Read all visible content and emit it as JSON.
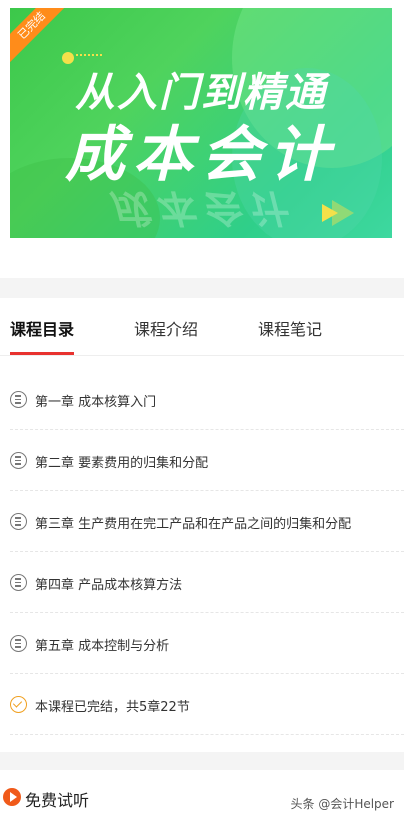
{
  "banner": {
    "badge": "已完结",
    "title_line1": "从入门到精通",
    "title_line2": "成本会计"
  },
  "tabs": [
    {
      "label": "课程目录",
      "active": true
    },
    {
      "label": "课程介绍",
      "active": false
    },
    {
      "label": "课程笔记",
      "active": false
    }
  ],
  "chapters": [
    {
      "label": "第一章  成本核算入门"
    },
    {
      "label": "第二章  要素费用的归集和分配"
    },
    {
      "label": "第三章  生产费用在完工产品和在产品之间的归集和分配"
    },
    {
      "label": "第四章  产品成本核算方法"
    },
    {
      "label": "第五章  成本控制与分析"
    }
  ],
  "status": {
    "label": "本课程已完结，共5章22节"
  },
  "trial": {
    "label": "免费试听"
  },
  "watermark": "头条 @会计Helper",
  "colors": {
    "accent": "#e8322f",
    "banner_green": "#3cc84a",
    "badge_orange": "#ff8c1a",
    "trial_orange": "#f05a1a"
  }
}
